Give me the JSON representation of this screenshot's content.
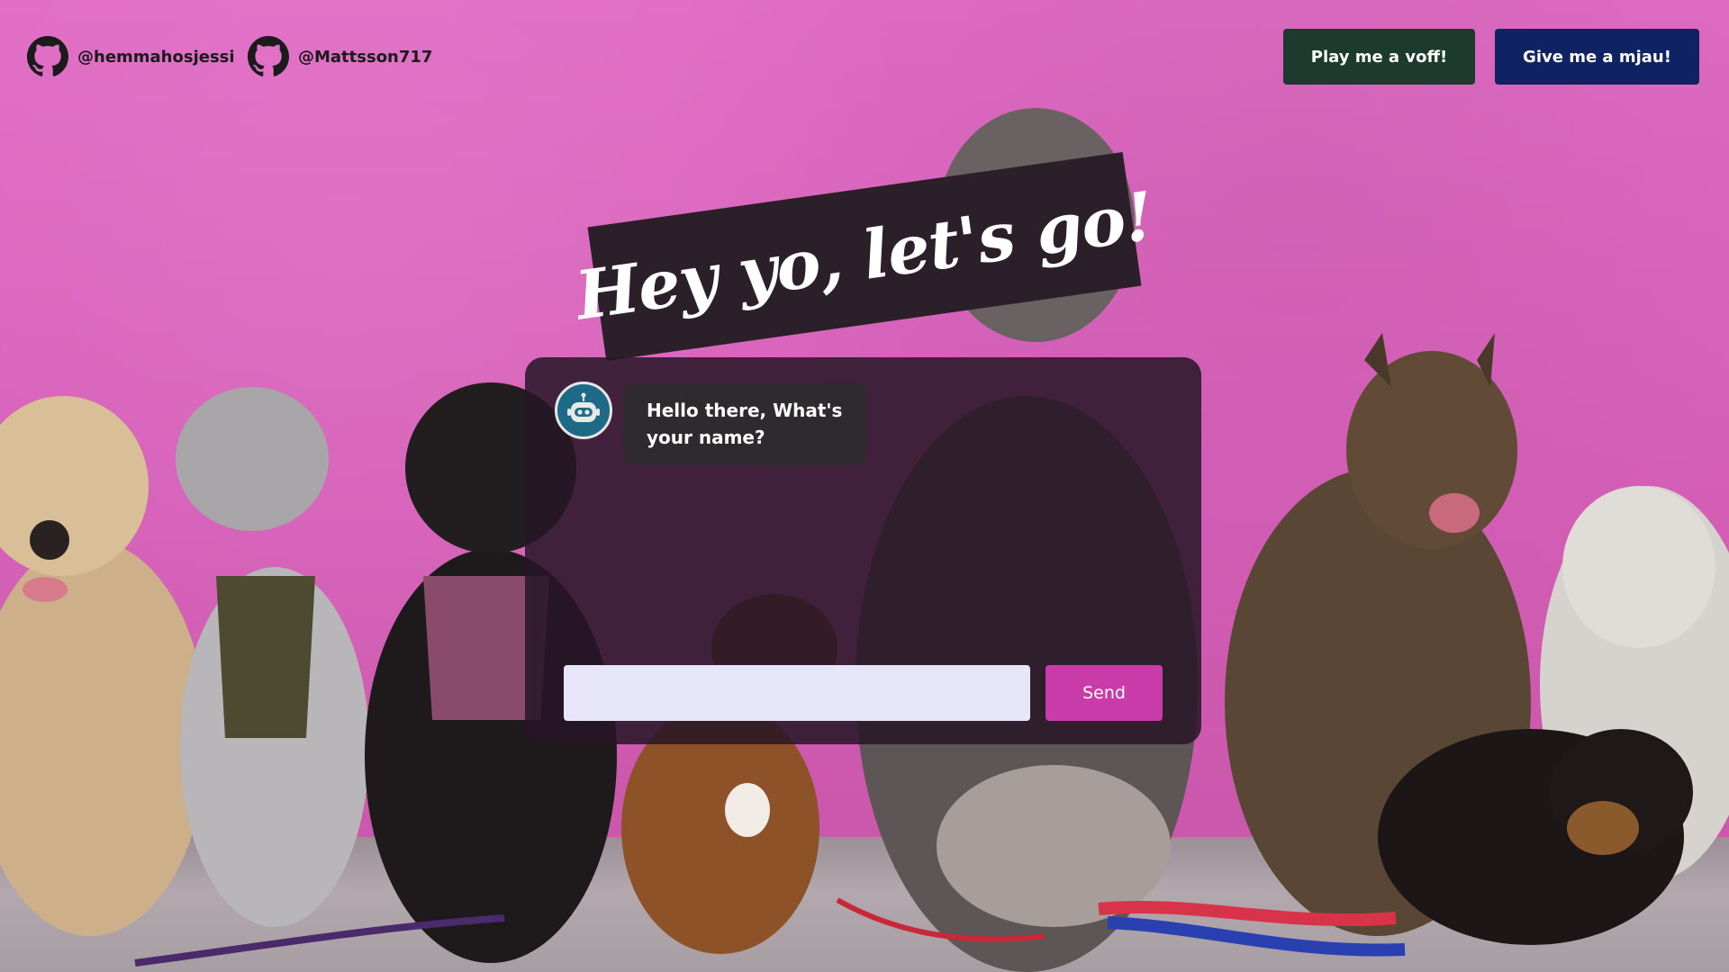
{
  "header": {
    "github_links": [
      {
        "label": "@hemmahosjessi",
        "icon": "github-icon"
      },
      {
        "label": "@Mattsson717",
        "icon": "github-icon"
      }
    ],
    "voff_button": "Play me a voff!",
    "mjau_button": "Give me a mjau!"
  },
  "banner": {
    "text": "Hey yo, let's go!"
  },
  "chat": {
    "bot_icon": "robot-icon",
    "messages": [
      {
        "sender": "bot",
        "text": "Hello there, What's your name?"
      }
    ],
    "input": {
      "value": "",
      "placeholder": ""
    },
    "send_label": "Send"
  },
  "colors": {
    "background_wall": "#d760b7",
    "voff_button": "#1d3a2e",
    "mjau_button": "#0f2363",
    "send_button": "#c93ba8",
    "input_background": "#e6e5fa",
    "chat_panel": "#281626",
    "bot_avatar": "#1d6a86"
  }
}
